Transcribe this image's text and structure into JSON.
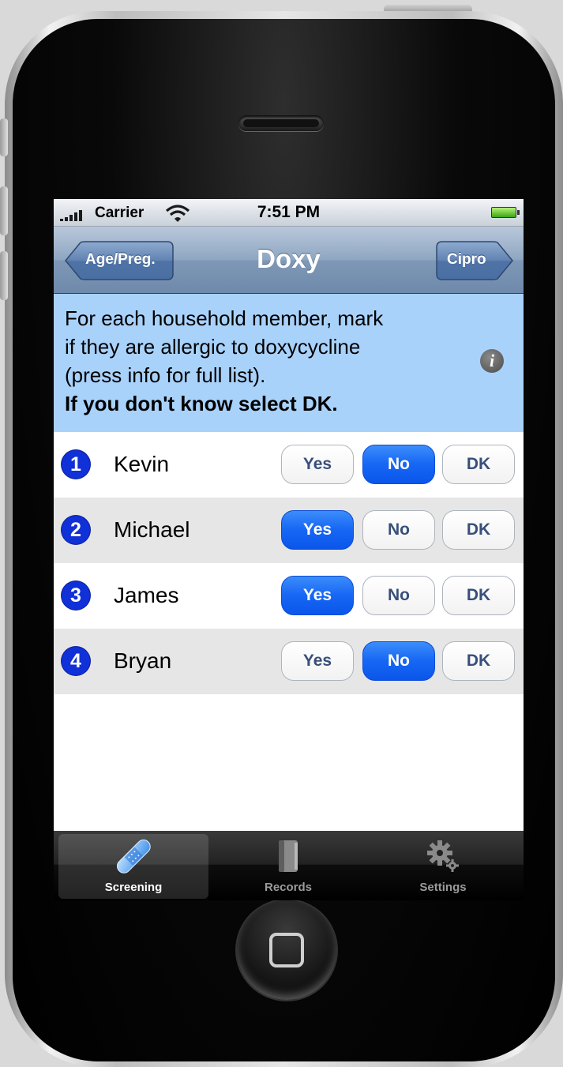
{
  "status_bar": {
    "carrier": "Carrier",
    "time": "7:51 PM"
  },
  "nav": {
    "back_label": "Age/Preg.",
    "title": "Doxy",
    "forward_label": "Cipro"
  },
  "instructions": {
    "line1": "For each household member, mark",
    "line2": "if they are allergic to doxycycline",
    "line3": "(press info for full list).",
    "line4": "If you don't know select DK.",
    "info_icon": "info-icon"
  },
  "options": {
    "yes": "Yes",
    "no": "No",
    "dk": "DK"
  },
  "members": [
    {
      "number": "1",
      "name": "Kevin",
      "selected": "No"
    },
    {
      "number": "2",
      "name": "Michael",
      "selected": "Yes"
    },
    {
      "number": "3",
      "name": "James",
      "selected": "Yes"
    },
    {
      "number": "4",
      "name": "Bryan",
      "selected": "No"
    }
  ],
  "tab_bar": {
    "tabs": [
      {
        "label": "Screening",
        "icon": "bandage-icon",
        "active": true
      },
      {
        "label": "Records",
        "icon": "book-icon",
        "active": false
      },
      {
        "label": "Settings",
        "icon": "gears-icon",
        "active": false
      }
    ]
  },
  "colors": {
    "instruction_bg": "#a9d2fb",
    "selected_option": "#1766f4",
    "number_badge": "#1030d8"
  }
}
